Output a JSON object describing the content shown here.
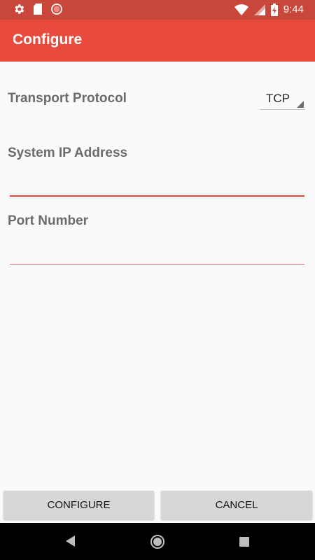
{
  "status_bar": {
    "time": "9:44",
    "icons": [
      "settings-icon",
      "sd-card-icon",
      "record-icon",
      "wifi-icon",
      "signal-icon",
      "battery-charging-icon"
    ]
  },
  "app_bar": {
    "title": "Configure"
  },
  "form": {
    "transport_label": "Transport Protocol",
    "transport_value": "TCP",
    "ip_label": "System IP Address",
    "ip_value": "",
    "port_label": "Port Number",
    "port_value": ""
  },
  "buttons": {
    "configure": "CONFIGURE",
    "cancel": "CANCEL"
  },
  "nav_bar": {
    "icons": [
      "back-icon",
      "home-icon",
      "recents-icon"
    ]
  },
  "colors": {
    "status_bar": "#c9463b",
    "app_bar": "#e84b3d",
    "accent": "#e0473b",
    "button": "#d6d7d7"
  }
}
